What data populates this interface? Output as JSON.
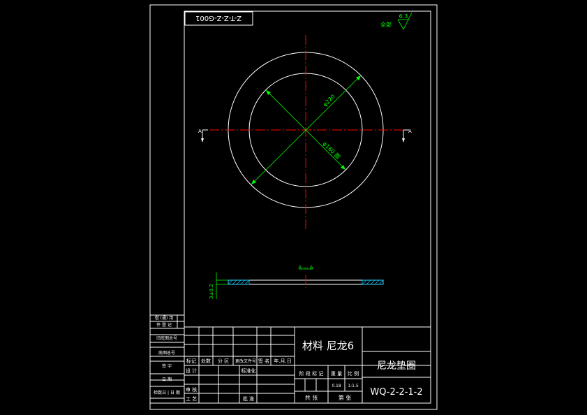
{
  "drawing": {
    "code_box": "Z-T-Z-Z-G001",
    "roughness_value": "6.3",
    "roughness_label": "全部",
    "dim_outer": "φ220",
    "dim_inner": "φ160 圆",
    "section_mark": "A",
    "section_title": "A — A",
    "thickness_dim": "3±0.2"
  },
  "side_labels": [
    "借 (通) 用",
    "件 登 记",
    "旧底图总号",
    "底图总号",
    "签 字",
    "日 期",
    "检数日 | 日 期"
  ],
  "title_block": {
    "material": "材料  尼龙6",
    "part_name": "尼龙垫圈",
    "drawing_no": "WQ-2-2-1-2",
    "rev_headers": [
      "标记",
      "处数",
      "分 区",
      "更改文件号",
      "签 名",
      "年.月.日"
    ],
    "role_design": "设 计",
    "role_std": "标准化",
    "role_check": "审 核",
    "role_process": "工 艺",
    "role_approve": "批 准",
    "stage_label": "阶 段 标 记",
    "weight_label": "重 量",
    "scale_label": "比 例",
    "weight_value": "0.18",
    "scale_value": "1:1.5",
    "sheet_total": "共     张",
    "sheet_no": "第     张"
  }
}
